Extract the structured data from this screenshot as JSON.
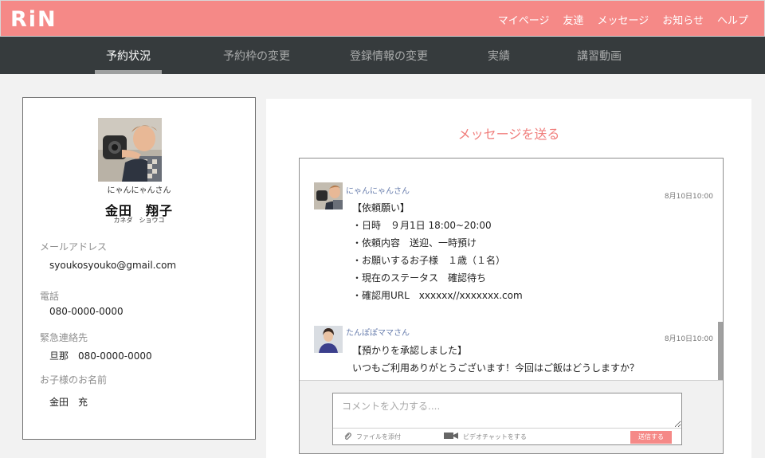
{
  "header": {
    "logo": "RiN",
    "nav": [
      "マイページ",
      "友達",
      "メッセージ",
      "お知らせ",
      "ヘルプ"
    ]
  },
  "tabs": [
    {
      "label": "予約状況",
      "active": true
    },
    {
      "label": "予約枠の変更",
      "active": false
    },
    {
      "label": "登録情報の変更",
      "active": false
    },
    {
      "label": "実績",
      "active": false
    },
    {
      "label": "講習動画",
      "active": false
    }
  ],
  "profile": {
    "nickname": "にゃんにゃんさん",
    "name": "金田　翔子",
    "kana": "カネダ　ショウコ",
    "fields": [
      {
        "label": "メールアドレス",
        "value": "syoukosyouko@gmail.com"
      },
      {
        "label": "電話",
        "value": "080-0000-0000"
      },
      {
        "label": "緊急連絡先",
        "value": "旦那　080-0000-0000"
      },
      {
        "label": "お子様のお名前",
        "value": "金田　充"
      }
    ]
  },
  "messages_panel": {
    "title": "メッセージを送る",
    "messages": [
      {
        "sender": "にゃんにゃんさん",
        "time": "8月10日10:00",
        "lines": [
          "【依頼願い】",
          "・日時　９月1日 18:00~20:00",
          "・依頼内容　送迎、一時預け",
          "・お願いするお子様　１歳（１名）",
          "・現在のステータス　確認待ち",
          "・確認用URL　xxxxxx//xxxxxxx.com"
        ]
      },
      {
        "sender": "たんぽぽママさん",
        "time": "8月10日10:00",
        "lines": [
          "【預かりを承認しました】",
          "いつもご利用ありがとうございます！今回はご飯はどうしますか？"
        ]
      }
    ],
    "composer": {
      "placeholder": "コメントを入力する....",
      "attach_label": "ファイルを添付",
      "video_label": "ビデオチャットをする",
      "send_label": "送信する"
    }
  },
  "colors": {
    "brand": "#f58987",
    "tabbar": "#363b3d",
    "title_accent": "#f07e7c"
  }
}
